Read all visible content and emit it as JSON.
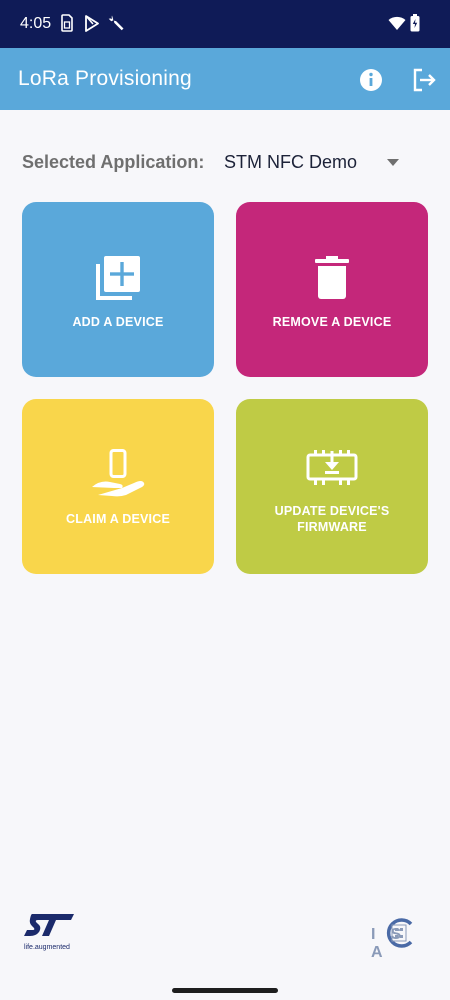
{
  "status_bar": {
    "time": "4:05"
  },
  "app_bar": {
    "title": "LoRa Provisioning"
  },
  "selector": {
    "label": "Selected Application:",
    "value": "STM NFC Demo"
  },
  "tiles": [
    {
      "label": "ADD A DEVICE",
      "color": "#5aa8da"
    },
    {
      "label": "REMOVE A DEVICE",
      "color": "#c4277a"
    },
    {
      "label": "CLAIM A DEVICE",
      "color": "#f9d64b"
    },
    {
      "label": "UPDATE DEVICE'S FIRMWARE",
      "color": "#bfcb45"
    }
  ],
  "footer": {
    "st_tagline": "life.augmented",
    "isca_text": "IS A"
  }
}
